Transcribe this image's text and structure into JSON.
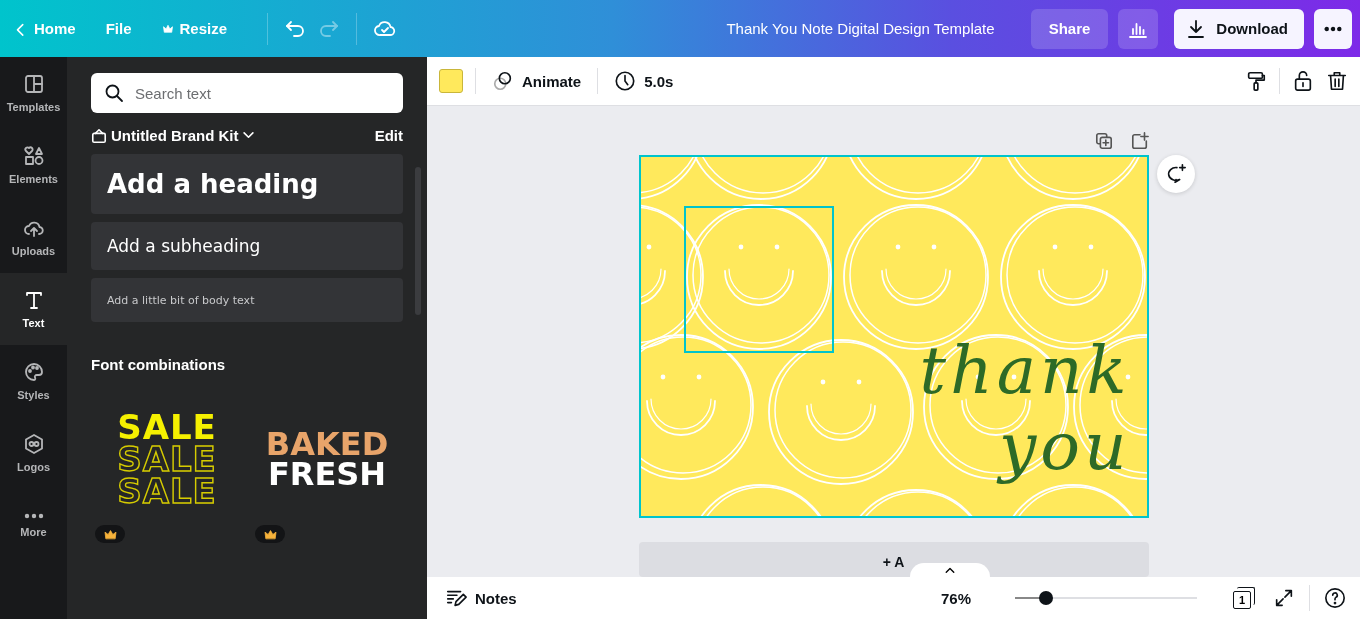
{
  "topbar": {
    "nav": [
      {
        "kind": "home",
        "label": "Home"
      },
      {
        "kind": "file",
        "label": "File"
      },
      {
        "kind": "resize",
        "label": "Resize"
      }
    ],
    "history": [
      {
        "kind": "undo",
        "disabled": false
      },
      {
        "kind": "redo",
        "disabled": true
      }
    ],
    "title": "Thank You Note Digital Design Template",
    "share": "Share",
    "download": "Download"
  },
  "rail": [
    {
      "label": "Templates",
      "selected": false
    },
    {
      "label": "Elements",
      "selected": false
    },
    {
      "label": "Uploads",
      "selected": false
    },
    {
      "label": "Text",
      "selected": true
    },
    {
      "label": "Styles",
      "selected": false
    },
    {
      "label": "Logos",
      "selected": false
    },
    {
      "label": "More",
      "selected": false
    }
  ],
  "panel": {
    "search": {
      "placeholder": "Search text"
    },
    "brand_kit": "Untitled Brand Kit",
    "edit": "Edit",
    "text_styles": [
      {
        "kind": "heading",
        "label": "Add a heading"
      },
      {
        "kind": "subheading",
        "label": "Add a subheading"
      },
      {
        "kind": "body",
        "label": "Add a little bit of body text"
      }
    ],
    "section_title": "Font combinations",
    "combinations": [
      {
        "kind": "sale",
        "lines": [
          "SALE",
          "SALE",
          "SALE"
        ],
        "premium": true
      },
      {
        "kind": "baked",
        "lines": [
          "BAKED",
          "FRESH"
        ],
        "premium": true
      }
    ]
  },
  "toolbar": {
    "animate": "Animate",
    "duration": "5.0s"
  },
  "design": {
    "lines": [
      "thank",
      "you"
    ]
  },
  "add_page": "+ A",
  "footer": {
    "notes": "Notes",
    "zoom": "76%",
    "zoom_slider": {
      "level": 0.14
    },
    "page_count": "1"
  }
}
